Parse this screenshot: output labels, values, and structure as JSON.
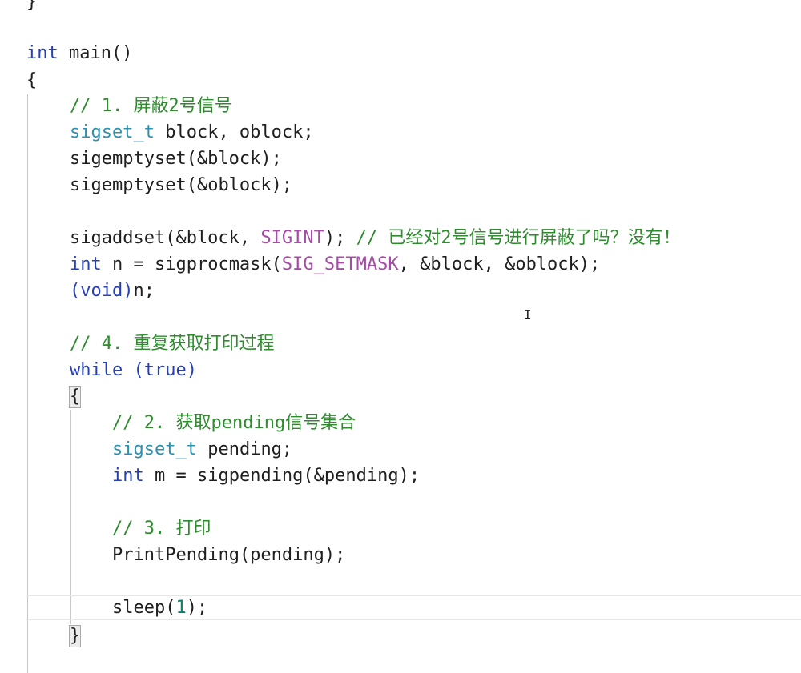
{
  "code": {
    "prev_close": "}",
    "main_sig_type": "int",
    "main_sig_rest": " main()",
    "open_brace": "{",
    "c1": "// 1. 屏蔽2号信号",
    "decl_type": "sigset_t",
    "decl_rest": " block, oblock;",
    "empty1": "sigemptyset(&block);",
    "empty2_a": "sigemptyset",
    "empty2_b": "(&oblock)",
    "empty2_c": ";",
    "add_a": "sigaddset(&block, ",
    "add_macro": "SIGINT",
    "add_b": "); ",
    "add_comment": "// 已经对2号信号进行屏蔽了吗？没有！",
    "mask_type": "int",
    "mask_a": " n = sigprocmask(",
    "mask_macro": "SIG_SETMASK",
    "mask_b": ", &block, &oblock);",
    "void_a": "(void)",
    "void_b": "n;",
    "c4": "// 4. 重复获取打印过程",
    "while_kw": "while",
    "while_rest": " (true)",
    "while_open": "{",
    "c2": "// 2. 获取pending信号集合",
    "pend_type": "sigset_t",
    "pend_rest": " pending;",
    "m_type": "int",
    "m_rest": " m = sigpending(&pending);",
    "c3": "// 3. 打印",
    "print_call": "PrintPending(pending);",
    "sleep_a": "sleep(",
    "sleep_num": "1",
    "sleep_b": ");",
    "while_close": "}"
  },
  "colors": {
    "keyword": "#2740b8",
    "type": "#2b91af",
    "comment": "#2e8b2e",
    "macro": "#a64ca6",
    "number": "#0d7d6c"
  },
  "cursor_icon": "ibeam-cursor-icon"
}
